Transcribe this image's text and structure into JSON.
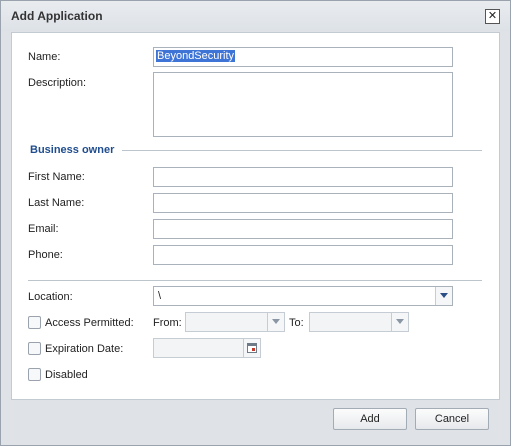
{
  "dialog": {
    "title": "Add Application"
  },
  "form": {
    "name_label": "Name:",
    "name_value": "BeyondSecurity",
    "description_label": "Description:",
    "description_value": "",
    "business_owner_title": "Business owner",
    "first_name_label": "First Name:",
    "last_name_label": "Last Name:",
    "email_label": "Email:",
    "phone_label": "Phone:",
    "location_label": "Location:",
    "location_value": "\\",
    "access_permitted_label": "Access Permitted:",
    "from_label": "From:",
    "to_label": "To:",
    "expiration_label": "Expiration Date:",
    "disabled_label": "Disabled"
  },
  "footer": {
    "add_label": "Add",
    "cancel_label": "Cancel"
  },
  "icons": {
    "close": "close-icon",
    "dropdown": "chevron-down-icon",
    "calendar": "calendar-icon"
  },
  "colors": {
    "section_title": "#1f4d8f",
    "selection": "#3d74d6"
  }
}
